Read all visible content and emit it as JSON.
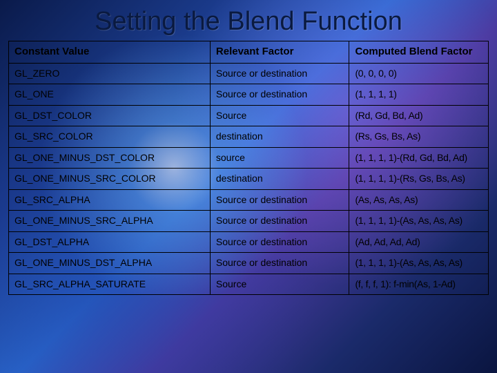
{
  "title": "Setting the Blend Function",
  "headers": {
    "c1": "Constant Value",
    "c2": "Relevant Factor",
    "c3": "Computed Blend Factor"
  },
  "chart_data": {
    "type": "table",
    "columns": [
      "Constant Value",
      "Relevant Factor",
      "Computed Blend Factor"
    ],
    "rows": [
      {
        "constant": "GL_ZERO",
        "factor": "Source or destination",
        "computed": "(0, 0, 0, 0)"
      },
      {
        "constant": "GL_ONE",
        "factor": "Source or destination",
        "computed": "(1, 1, 1, 1)"
      },
      {
        "constant": "GL_DST_COLOR",
        "factor": "Source",
        "computed": "(Rd, Gd, Bd, Ad)"
      },
      {
        "constant": "GL_SRC_COLOR",
        "factor": "destination",
        "computed": "(Rs, Gs, Bs, As)"
      },
      {
        "constant": "GL_ONE_MINUS_DST_COLOR",
        "factor": "source",
        "computed": "(1, 1, 1, 1)-(Rd, Gd, Bd, Ad)"
      },
      {
        "constant": "GL_ONE_MINUS_SRC_COLOR",
        "factor": "destination",
        "computed": "(1, 1, 1, 1)-(Rs, Gs, Bs, As)"
      },
      {
        "constant": "GL_SRC_ALPHA",
        "factor": "Source or destination",
        "computed": "(As, As, As, As)"
      },
      {
        "constant": "GL_ONE_MINUS_SRC_ALPHA",
        "factor": "Source or destination",
        "computed": "(1, 1, 1, 1)-(As, As, As, As)"
      },
      {
        "constant": "GL_DST_ALPHA",
        "factor": "Source or destination",
        "computed": "(Ad, Ad, Ad, Ad)"
      },
      {
        "constant": "GL_ONE_MINUS_DST_ALPHA",
        "factor": "Source or destination",
        "computed": "(1, 1, 1, 1)-(As, As, As, As)"
      },
      {
        "constant": "GL_SRC_ALPHA_SATURATE",
        "factor": "Source",
        "computed": "(f, f, f, 1): f-min(As, 1-Ad)"
      }
    ]
  }
}
